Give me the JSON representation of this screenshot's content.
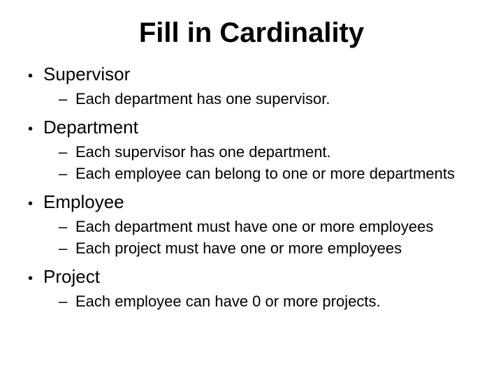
{
  "title": "Fill in Cardinality",
  "items": [
    {
      "label": "Supervisor",
      "sub": [
        "Each department has one supervisor."
      ]
    },
    {
      "label": "Department",
      "sub": [
        "Each supervisor has one department.",
        "Each employee can belong to one or more departments"
      ]
    },
    {
      "label": "Employee",
      "sub": [
        "Each department must have one or more employees",
        "Each project must have one or more employees"
      ]
    },
    {
      "label": "Project",
      "sub": [
        "Each employee can have 0 or more projects."
      ]
    }
  ]
}
